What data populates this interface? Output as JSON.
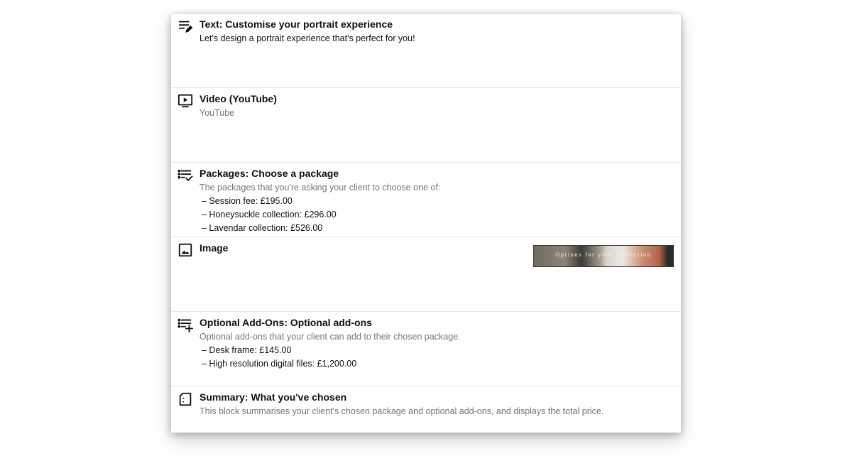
{
  "blocks": {
    "text": {
      "icon": "text-edit-icon",
      "title": "Text: Customise your portrait experience",
      "description": "Let's design a portrait experience that's perfect for you!"
    },
    "video": {
      "icon": "video-play-icon",
      "title": "Video (YouTube)",
      "description": "YouTube"
    },
    "packages": {
      "icon": "checklist-icon",
      "title": "Packages: Choose a package",
      "description": "The packages that you're asking your client to choose one of:",
      "items": [
        "– Session fee: £195.00",
        "– Honeysuckle collection: £296.00",
        "– Lavendar collection: £526.00"
      ]
    },
    "image": {
      "icon": "image-icon",
      "title": "Image",
      "thumbnail_caption": "Options for your collection"
    },
    "addons": {
      "icon": "list-add-icon",
      "title": "Optional Add-Ons: Optional add-ons",
      "description": "Optional add-ons that your client can add to their chosen package.",
      "items": [
        "– Desk frame: £145.00",
        "– High resolution digital files: £1,200.00"
      ]
    },
    "summary": {
      "icon": "summary-icon",
      "title": "Summary: What you've chosen",
      "description": "This block summarises your client's chosen package and optional add-ons, and displays the total price."
    }
  },
  "colors": {
    "title": "#111111",
    "muted": "#777777",
    "divider": "#e6e6e6"
  }
}
